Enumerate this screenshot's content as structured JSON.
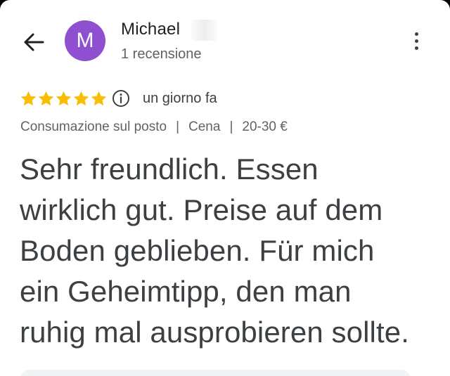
{
  "header": {
    "back_icon": "arrow-left-icon",
    "avatar_letter": "M",
    "avatar_color": "#8e4fd0",
    "user_name": "Michael",
    "review_count": "1 recensione",
    "menu_icon": "more-vert-icon"
  },
  "rating": {
    "stars": 5,
    "max_stars": 5,
    "star_color": "#fbbc04",
    "info_icon": "info-icon",
    "time_ago": "un giorno fa"
  },
  "meta": {
    "service": "Consumazione sul posto",
    "separator": "|",
    "meal": "Cena",
    "price": "20-30 €"
  },
  "review": {
    "text_lines": [
      "Sehr freundlich. Essen",
      "wirklich gut. Preise auf dem",
      "Boden geblieben. Für mich",
      "ein Geheimtipp, den man",
      "ruhig mal ausprobieren sollte."
    ]
  }
}
